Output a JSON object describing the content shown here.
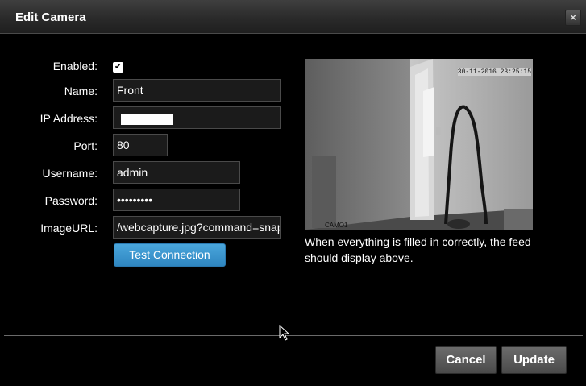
{
  "dialog": {
    "title": "Edit Camera",
    "close_label": "×"
  },
  "form": {
    "enabled": {
      "label": "Enabled:",
      "checked": true
    },
    "name": {
      "label": "Name:",
      "value": "Front"
    },
    "ip_address": {
      "label": "IP Address:",
      "value": ""
    },
    "port": {
      "label": "Port:",
      "value": "80"
    },
    "username": {
      "label": "Username:",
      "value": "admin"
    },
    "password": {
      "label": "Password:",
      "value": "•••••••••"
    },
    "image_url": {
      "label": "ImageURL:",
      "value": "/webcapture.jpg?command=snap"
    },
    "test_button": "Test Connection"
  },
  "preview": {
    "timestamp": "30-11-2016 23:25:15",
    "camera_label": "CAMO1",
    "hint": "When everything is filled in correctly, the feed should display above."
  },
  "footer": {
    "cancel_label": "Cancel",
    "update_label": "Update"
  }
}
